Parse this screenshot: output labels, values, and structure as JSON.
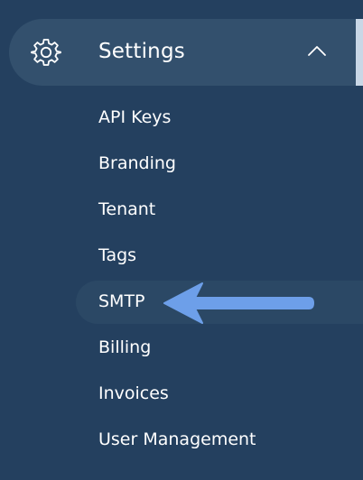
{
  "header": {
    "label": "Settings",
    "icon": "gear-icon",
    "expand_icon": "chevron-up-icon"
  },
  "subnav": {
    "items": [
      {
        "label": "API Keys"
      },
      {
        "label": "Branding"
      },
      {
        "label": "Tenant"
      },
      {
        "label": "Tags"
      },
      {
        "label": "SMTP",
        "active": true
      },
      {
        "label": "Billing"
      },
      {
        "label": "Invoices"
      },
      {
        "label": "User Management"
      }
    ]
  },
  "colors": {
    "background": "#24405f",
    "header_bg": "#33506d",
    "active_bg": "#2b4865",
    "text": "#ffffff",
    "annotation_arrow": "#6d9fe9"
  }
}
